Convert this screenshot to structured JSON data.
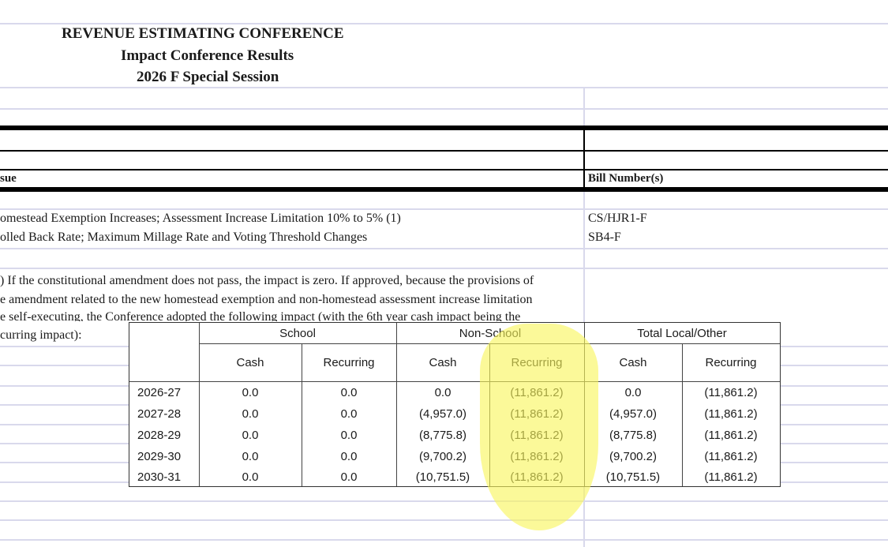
{
  "titles": {
    "line1": "REVENUE ESTIMATING CONFERENCE",
    "line2": "Impact Conference Results",
    "line3": "2026 F Special Session"
  },
  "headers": {
    "issue": "sue",
    "bill_numbers": "Bill Number(s)"
  },
  "issues": [
    {
      "text": "omestead Exemption Increases; Assessment Increase Limitation 10% to 5% (1)",
      "bill": "CS/HJR1-F"
    },
    {
      "text": "olled Back Rate; Maximum Millage Rate and Voting Threshold Changes",
      "bill": "SB4-F"
    }
  ],
  "note_lines": [
    ") If the constitutional amendment does not pass, the impact is zero. If approved, because the provisions of",
    "e amendment related to the new homestead exemption and non-homestead assessment increase limitation",
    "e self-executing, the Conference adopted the following impact (with the 6th year cash impact being the",
    "curring impact):"
  ],
  "impact_table": {
    "groups": [
      "School",
      "Non-School",
      "Total Local/Other"
    ],
    "subheaders": [
      "Cash",
      "Recurring",
      "Cash",
      "Recurring",
      "Cash",
      "Recurring"
    ],
    "rows": [
      {
        "year": "2026-27",
        "values": [
          "0.0",
          "0.0",
          "0.0",
          "(11,861.2)",
          "0.0",
          "(11,861.2)"
        ]
      },
      {
        "year": "2027-28",
        "values": [
          "0.0",
          "0.0",
          "(4,957.0)",
          "(11,861.2)",
          "(4,957.0)",
          "(11,861.2)"
        ]
      },
      {
        "year": "2028-29",
        "values": [
          "0.0",
          "0.0",
          "(8,775.8)",
          "(11,861.2)",
          "(8,775.8)",
          "(11,861.2)"
        ]
      },
      {
        "year": "2029-30",
        "values": [
          "0.0",
          "0.0",
          "(9,700.2)",
          "(11,861.2)",
          "(9,700.2)",
          "(11,861.2)"
        ]
      },
      {
        "year": "2030-31",
        "values": [
          "0.0",
          "0.0",
          "(10,751.5)",
          "(11,861.2)",
          "(10,751.5)",
          "(11,861.2)"
        ]
      }
    ]
  },
  "colors": {
    "gridline": "#d9d9ec",
    "highlight": "#f8f65a"
  }
}
